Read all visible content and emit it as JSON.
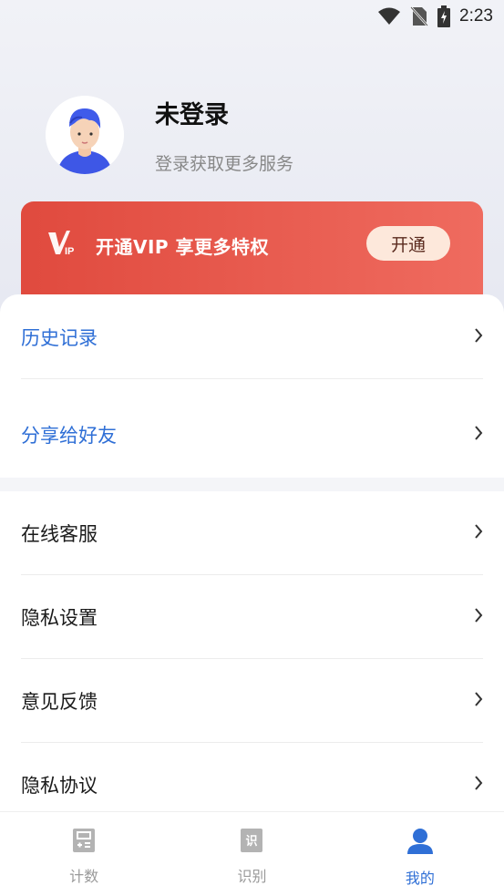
{
  "status_bar": {
    "time": "2:23"
  },
  "profile": {
    "title": "未登录",
    "subtitle": "登录获取更多服务"
  },
  "vip": {
    "logo_text": "VIP",
    "text": "开通VIP  享更多特权",
    "button": "开通"
  },
  "menu_group_1": [
    {
      "label": "历史记录"
    },
    {
      "label": "分享给好友"
    }
  ],
  "menu_group_2": [
    {
      "label": "在线客服"
    },
    {
      "label": "隐私设置"
    },
    {
      "label": "意见反馈"
    },
    {
      "label": "隐私协议"
    }
  ],
  "tabs": [
    {
      "label": "计数",
      "icon": "count-icon",
      "active": false
    },
    {
      "label": "识别",
      "icon": "recognize-icon",
      "active": false
    },
    {
      "label": "我的",
      "icon": "user-icon",
      "active": true
    }
  ],
  "colors": {
    "accent": "#2f6fd6",
    "vip_start": "#e04a3e",
    "vip_end": "#ef6b5f"
  }
}
